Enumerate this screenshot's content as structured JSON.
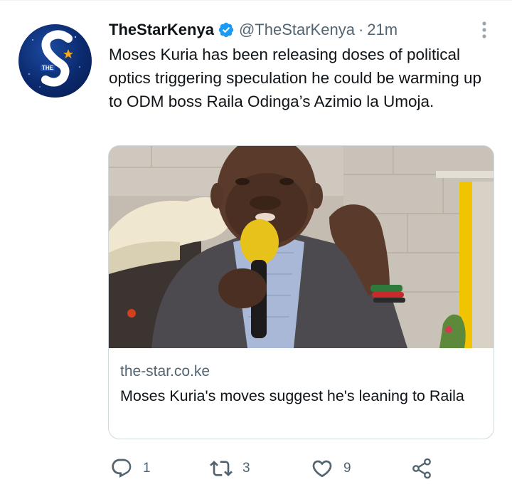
{
  "tweet": {
    "display_name": "TheStarKenya",
    "handle": "@TheStarKenya",
    "separator": "·",
    "time": "21m",
    "text": "Moses Kuria has been releasing doses of political optics triggering speculation he could be warming up to ODM boss Raila Odinga’s Azimio la Umoja.",
    "avatar_icon": "star-logo-avatar",
    "verified_icon": "verified-badge-icon",
    "colors": {
      "verified": "#1d9bf0",
      "secondary_text": "#536471",
      "primary_text": "#0f1419"
    }
  },
  "card": {
    "image_icon": "article-photo",
    "domain": "the-star.co.ke",
    "title": "Moses Kuria's moves suggest he's leaning to Raila"
  },
  "actions": {
    "reply_count": "1",
    "retweet_count": "3",
    "like_count": "9"
  }
}
